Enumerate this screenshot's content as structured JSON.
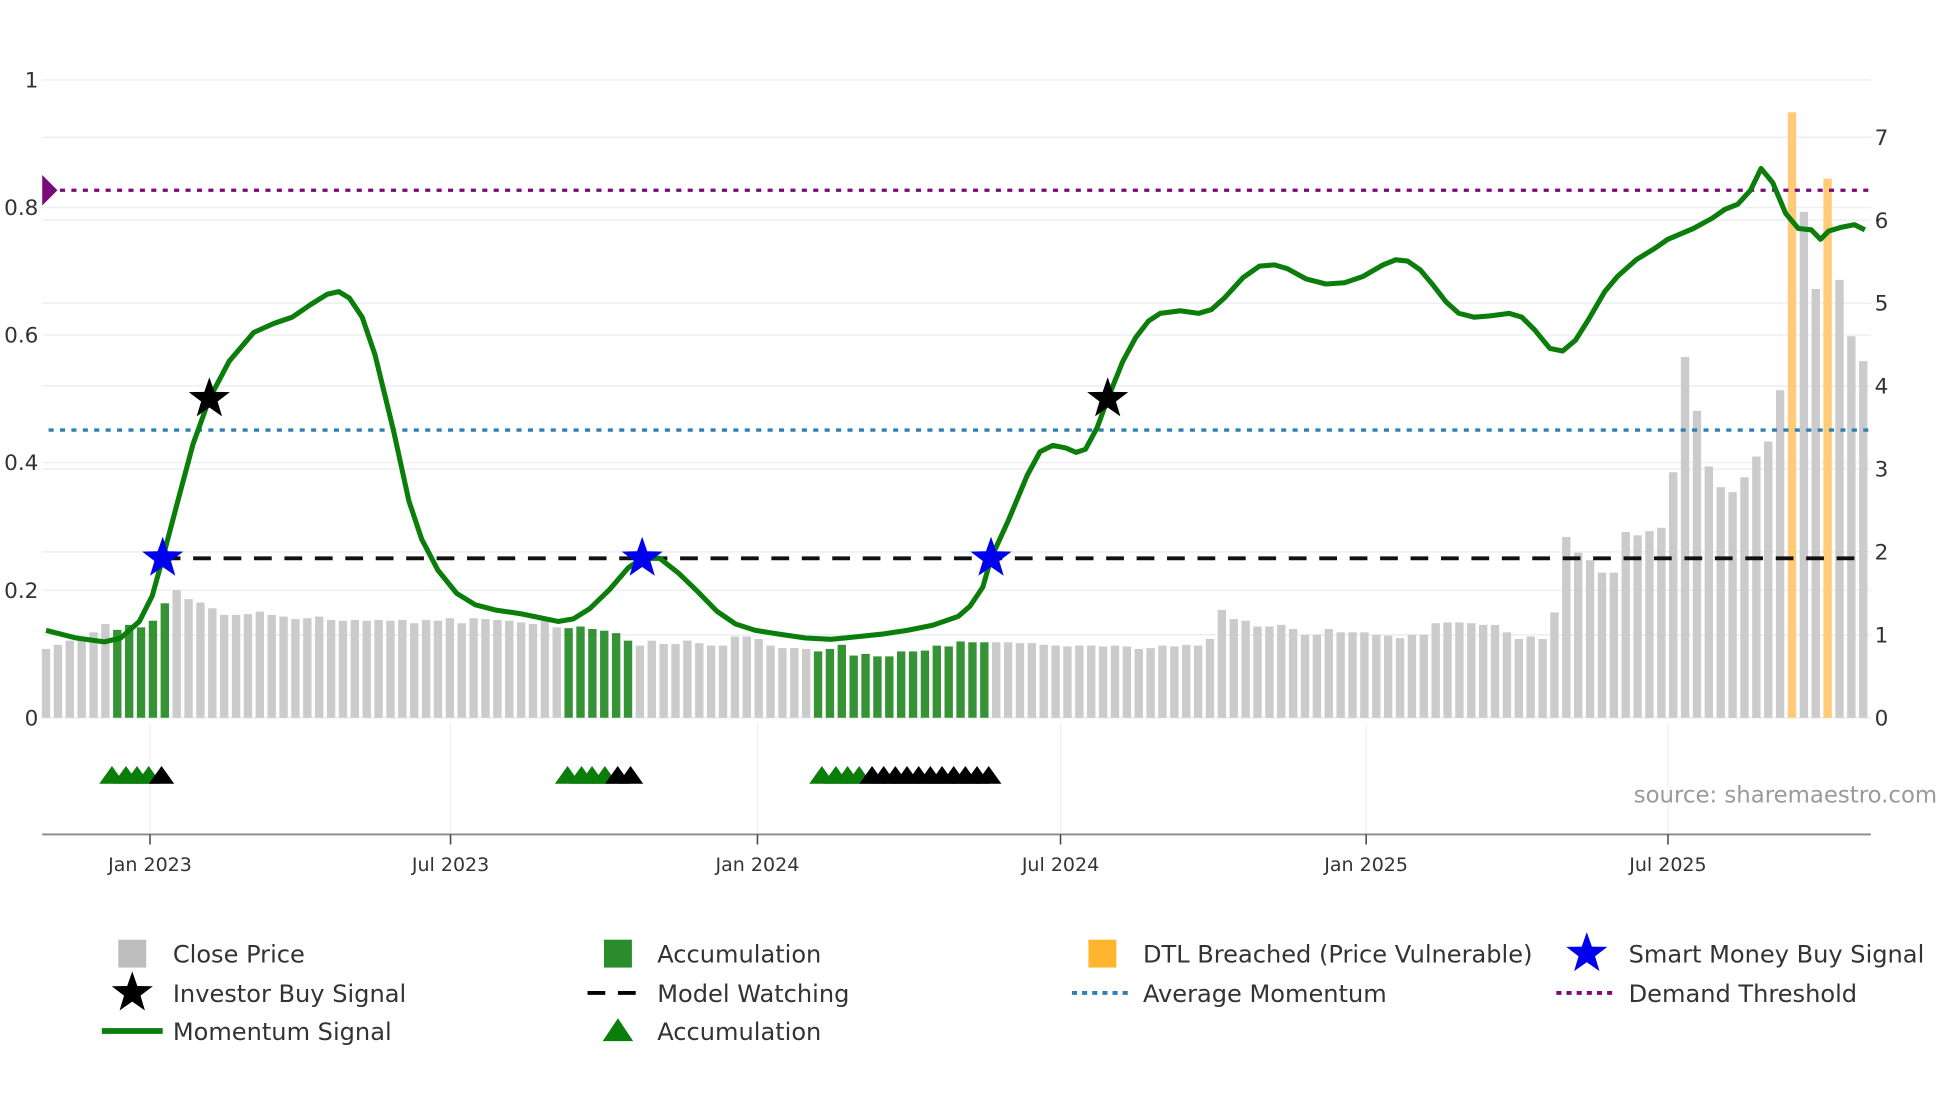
{
  "chart_data": {
    "type": "bar+line",
    "x_start": "2022-10-30",
    "x_step": "1 week",
    "source": "source: sharemaestro.com",
    "left_axis": {
      "ticks": [
        "0",
        "0.2",
        "0.4",
        "0.6",
        "0.8",
        "1"
      ],
      "range": [
        0,
        1
      ]
    },
    "right_axis": {
      "ticks": [
        "0",
        "1",
        "2",
        "3",
        "4",
        "5",
        "6",
        "7"
      ],
      "range": [
        0,
        7
      ]
    },
    "x_ticks": [
      "Jan 2023",
      "Jul 2023",
      "Jan 2024",
      "Jul 2024",
      "Jan 2025",
      "Jul 2025"
    ],
    "close_price": [
      0.83,
      0.88,
      0.93,
      0.98,
      1.03,
      1.13,
      1.06,
      1.12,
      1.09,
      1.17,
      1.38,
      1.54,
      1.43,
      1.39,
      1.32,
      1.24,
      1.24,
      1.25,
      1.28,
      1.24,
      1.22,
      1.19,
      1.2,
      1.22,
      1.18,
      1.17,
      1.18,
      1.17,
      1.18,
      1.17,
      1.18,
      1.14,
      1.18,
      1.17,
      1.2,
      1.14,
      1.2,
      1.19,
      1.18,
      1.17,
      1.15,
      1.13,
      1.17,
      1.09,
      1.08,
      1.1,
      1.07,
      1.05,
      1.02,
      0.93,
      0.87,
      0.93,
      0.89,
      0.89,
      0.93,
      0.9,
      0.87,
      0.87,
      0.98,
      0.98,
      0.95,
      0.87,
      0.84,
      0.84,
      0.83,
      0.8,
      0.83,
      0.88,
      0.75,
      0.77,
      0.74,
      0.74,
      0.8,
      0.8,
      0.81,
      0.87,
      0.86,
      0.92,
      0.91,
      0.91,
      0.91,
      0.91,
      0.9,
      0.9,
      0.88,
      0.87,
      0.86,
      0.87,
      0.87,
      0.86,
      0.87,
      0.86,
      0.83,
      0.84,
      0.87,
      0.86,
      0.88,
      0.87,
      0.95,
      1.3,
      1.19,
      1.17,
      1.1,
      1.1,
      1.12,
      1.07,
      1.0,
      1.0,
      1.07,
      1.03,
      1.03,
      1.03,
      1.0,
      0.99,
      0.96,
      1.0,
      1.0,
      1.14,
      1.15,
      1.15,
      1.14,
      1.12,
      1.12,
      1.03,
      0.95,
      0.98,
      0.95,
      1.27,
      2.18,
      1.99,
      1.9,
      1.75,
      1.75,
      2.24,
      2.2,
      2.25,
      2.29,
      2.96,
      4.35,
      3.7,
      3.03,
      2.78,
      2.72,
      2.9,
      3.15,
      3.33,
      3.95,
      7.3,
      6.1,
      5.17,
      6.5,
      5.28,
      4.6,
      4.3
    ],
    "accumulation_bar_ranges": [
      [
        6,
        10
      ],
      [
        44,
        49
      ],
      [
        65,
        79
      ]
    ],
    "dtl_breached_bars": [
      147,
      150
    ],
    "momentum_signal": [
      [
        0,
        0.137
      ],
      [
        2.6,
        0.125
      ],
      [
        5.0,
        0.119
      ],
      [
        6.4,
        0.125
      ],
      [
        8.0,
        0.151
      ],
      [
        9.1,
        0.191
      ],
      [
        10.0,
        0.25
      ],
      [
        11.3,
        0.34
      ],
      [
        12.6,
        0.429
      ],
      [
        14.0,
        0.5
      ],
      [
        15.7,
        0.559
      ],
      [
        17.8,
        0.604
      ],
      [
        19.5,
        0.618
      ],
      [
        21.1,
        0.628
      ],
      [
        22.7,
        0.648
      ],
      [
        24.1,
        0.664
      ],
      [
        25.1,
        0.668
      ],
      [
        26.0,
        0.658
      ],
      [
        27.1,
        0.628
      ],
      [
        28.2,
        0.569
      ],
      [
        29.8,
        0.449
      ],
      [
        31.1,
        0.34
      ],
      [
        32.2,
        0.28
      ],
      [
        33.6,
        0.231
      ],
      [
        35.2,
        0.195
      ],
      [
        36.8,
        0.177
      ],
      [
        38.5,
        0.169
      ],
      [
        40.7,
        0.163
      ],
      [
        42.3,
        0.157
      ],
      [
        43.9,
        0.151
      ],
      [
        45.2,
        0.155
      ],
      [
        46.6,
        0.171
      ],
      [
        48.3,
        0.201
      ],
      [
        49.9,
        0.235
      ],
      [
        51.1,
        0.25
      ],
      [
        52.6,
        0.25
      ],
      [
        54.2,
        0.227
      ],
      [
        55.9,
        0.197
      ],
      [
        57.5,
        0.167
      ],
      [
        59.1,
        0.147
      ],
      [
        60.8,
        0.137
      ],
      [
        62.9,
        0.131
      ],
      [
        65.1,
        0.125
      ],
      [
        67.3,
        0.123
      ],
      [
        69.5,
        0.127
      ],
      [
        71.6,
        0.131
      ],
      [
        73.8,
        0.137
      ],
      [
        76.0,
        0.145
      ],
      [
        78.2,
        0.159
      ],
      [
        79.2,
        0.175
      ],
      [
        80.3,
        0.205
      ],
      [
        81.0,
        0.25
      ],
      [
        82.5,
        0.31
      ],
      [
        84.1,
        0.38
      ],
      [
        85.2,
        0.417
      ],
      [
        86.3,
        0.427
      ],
      [
        87.4,
        0.423
      ],
      [
        88.3,
        0.416
      ],
      [
        89.1,
        0.421
      ],
      [
        90.1,
        0.455
      ],
      [
        91.0,
        0.5
      ],
      [
        92.3,
        0.559
      ],
      [
        93.4,
        0.596
      ],
      [
        94.5,
        0.622
      ],
      [
        95.5,
        0.634
      ],
      [
        97.2,
        0.638
      ],
      [
        98.8,
        0.634
      ],
      [
        99.9,
        0.64
      ],
      [
        101.0,
        0.658
      ],
      [
        102.6,
        0.69
      ],
      [
        104.0,
        0.708
      ],
      [
        105.3,
        0.71
      ],
      [
        106.4,
        0.704
      ],
      [
        108.0,
        0.688
      ],
      [
        109.7,
        0.68
      ],
      [
        111.3,
        0.682
      ],
      [
        112.9,
        0.692
      ],
      [
        114.6,
        0.71
      ],
      [
        115.7,
        0.718
      ],
      [
        116.7,
        0.716
      ],
      [
        117.8,
        0.702
      ],
      [
        118.9,
        0.678
      ],
      [
        120.0,
        0.652
      ],
      [
        121.1,
        0.634
      ],
      [
        122.4,
        0.628
      ],
      [
        123.8,
        0.63
      ],
      [
        125.4,
        0.634
      ],
      [
        126.5,
        0.628
      ],
      [
        127.6,
        0.608
      ],
      [
        128.9,
        0.579
      ],
      [
        130.0,
        0.575
      ],
      [
        131.1,
        0.592
      ],
      [
        132.2,
        0.624
      ],
      [
        133.6,
        0.668
      ],
      [
        134.7,
        0.692
      ],
      [
        136.3,
        0.718
      ],
      [
        137.9,
        0.736
      ],
      [
        139.0,
        0.75
      ],
      [
        141.2,
        0.767
      ],
      [
        142.8,
        0.783
      ],
      [
        143.9,
        0.797
      ],
      [
        145.0,
        0.805
      ],
      [
        146.1,
        0.827
      ],
      [
        147.0,
        0.861
      ],
      [
        148.0,
        0.839
      ],
      [
        149.1,
        0.791
      ],
      [
        150.2,
        0.767
      ],
      [
        151.3,
        0.765
      ],
      [
        152.1,
        0.75
      ],
      [
        152.8,
        0.763
      ],
      [
        153.9,
        0.769
      ],
      [
        155.0,
        0.773
      ],
      [
        155.9,
        0.765
      ]
    ],
    "investor_buy_signals": [
      [
        14.0,
        0.5
      ],
      [
        91.0,
        0.5
      ]
    ],
    "smart_money_buy_signals": [
      [
        10.0,
        0.25
      ],
      [
        51.1,
        0.25
      ],
      [
        81.0,
        0.25
      ]
    ],
    "model_watching": {
      "value": 0.25,
      "from_week": 10.0
    },
    "average_momentum": 0.451,
    "demand_threshold": 0.827,
    "accumulation_markers": [
      [
        5.65,
        "green"
      ],
      [
        6.85,
        "green"
      ],
      [
        7.8,
        "green"
      ],
      [
        8.8,
        "green"
      ],
      [
        9.9,
        "black"
      ],
      [
        44.7,
        "green"
      ],
      [
        45.9,
        "green"
      ],
      [
        46.8,
        "green"
      ],
      [
        47.9,
        "green"
      ],
      [
        49.0,
        "black"
      ],
      [
        50.1,
        "black"
      ],
      [
        66.5,
        "green"
      ],
      [
        67.7,
        "green"
      ],
      [
        68.7,
        "green"
      ],
      [
        69.7,
        "green"
      ],
      [
        70.8,
        "black"
      ],
      [
        71.8,
        "black"
      ],
      [
        72.8,
        "black"
      ],
      [
        73.8,
        "black"
      ],
      [
        74.8,
        "black"
      ],
      [
        75.8,
        "black"
      ],
      [
        76.8,
        "black"
      ],
      [
        77.8,
        "black"
      ],
      [
        78.8,
        "black"
      ],
      [
        79.8,
        "black"
      ],
      [
        80.8,
        "black"
      ]
    ],
    "colors": {
      "close": "#c8c8c8",
      "accumulation": "#2a8c2a",
      "dtl": "#ffc870",
      "momentum": "#0a7d0a",
      "investor": "#000000",
      "smart_money": "#0000ee",
      "avg": "#2f7fb5",
      "threshold": "#7a0a7a",
      "watching": "#111111"
    },
    "legend": [
      {
        "label": "Close Price",
        "icon": "square-grey"
      },
      {
        "label": "Accumulation",
        "icon": "square-green"
      },
      {
        "label": "DTL Breached (Price Vulnerable)",
        "icon": "square-orange"
      },
      {
        "label": "Smart Money Buy Signal",
        "icon": "star-blue"
      },
      {
        "label": "Investor Buy Signal",
        "icon": "star-black"
      },
      {
        "label": "Model Watching",
        "icon": "dash-black"
      },
      {
        "label": "Average Momentum",
        "icon": "dot-blue"
      },
      {
        "label": "Demand Threshold",
        "icon": "dot-purple"
      },
      {
        "label": "Momentum Signal",
        "icon": "line-green"
      },
      {
        "label": "Accumulation",
        "icon": "triangle-green"
      }
    ]
  }
}
